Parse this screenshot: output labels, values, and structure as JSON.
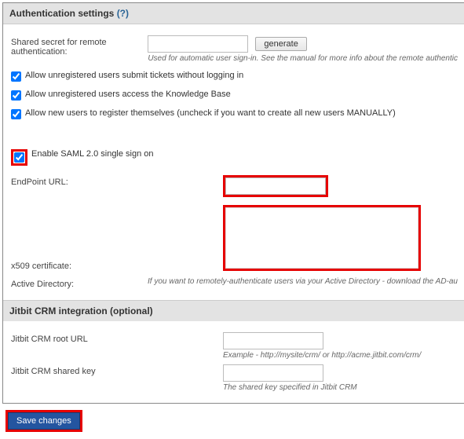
{
  "auth": {
    "title": "Authentication settings",
    "help": "(?)",
    "shared_secret_label": "Shared secret for remote authentication:",
    "generate_label": "generate",
    "shared_secret_hint": "Used for automatic user sign-in. See the manual for more info about the remote authentic",
    "chk_unreg_tickets": "Allow unregistered users submit tickets without logging in",
    "chk_unreg_kb": "Allow unregistered users access the Knowledge Base",
    "chk_new_users": "Allow new users to register themselves (uncheck if you want to create all new users MANUALLY)",
    "chk_saml": "Enable SAML 2.0 single sign on",
    "endpoint_label": "EndPoint URL:",
    "x509_label": "x509 certificate:",
    "active_dir_label": "Active Directory:",
    "active_dir_hint": "If you want to remotely-authenticate users via your Active Directory - download the AD-au"
  },
  "crm": {
    "title": "Jitbit CRM integration (optional)",
    "root_label": "Jitbit CRM root URL",
    "root_hint": "Example - http://mysite/crm/ or http://acme.jitbit.com/crm/",
    "key_label": "Jitbit CRM shared key",
    "key_hint": "The shared key specified in Jitbit CRM"
  },
  "save_label": "Save changes"
}
